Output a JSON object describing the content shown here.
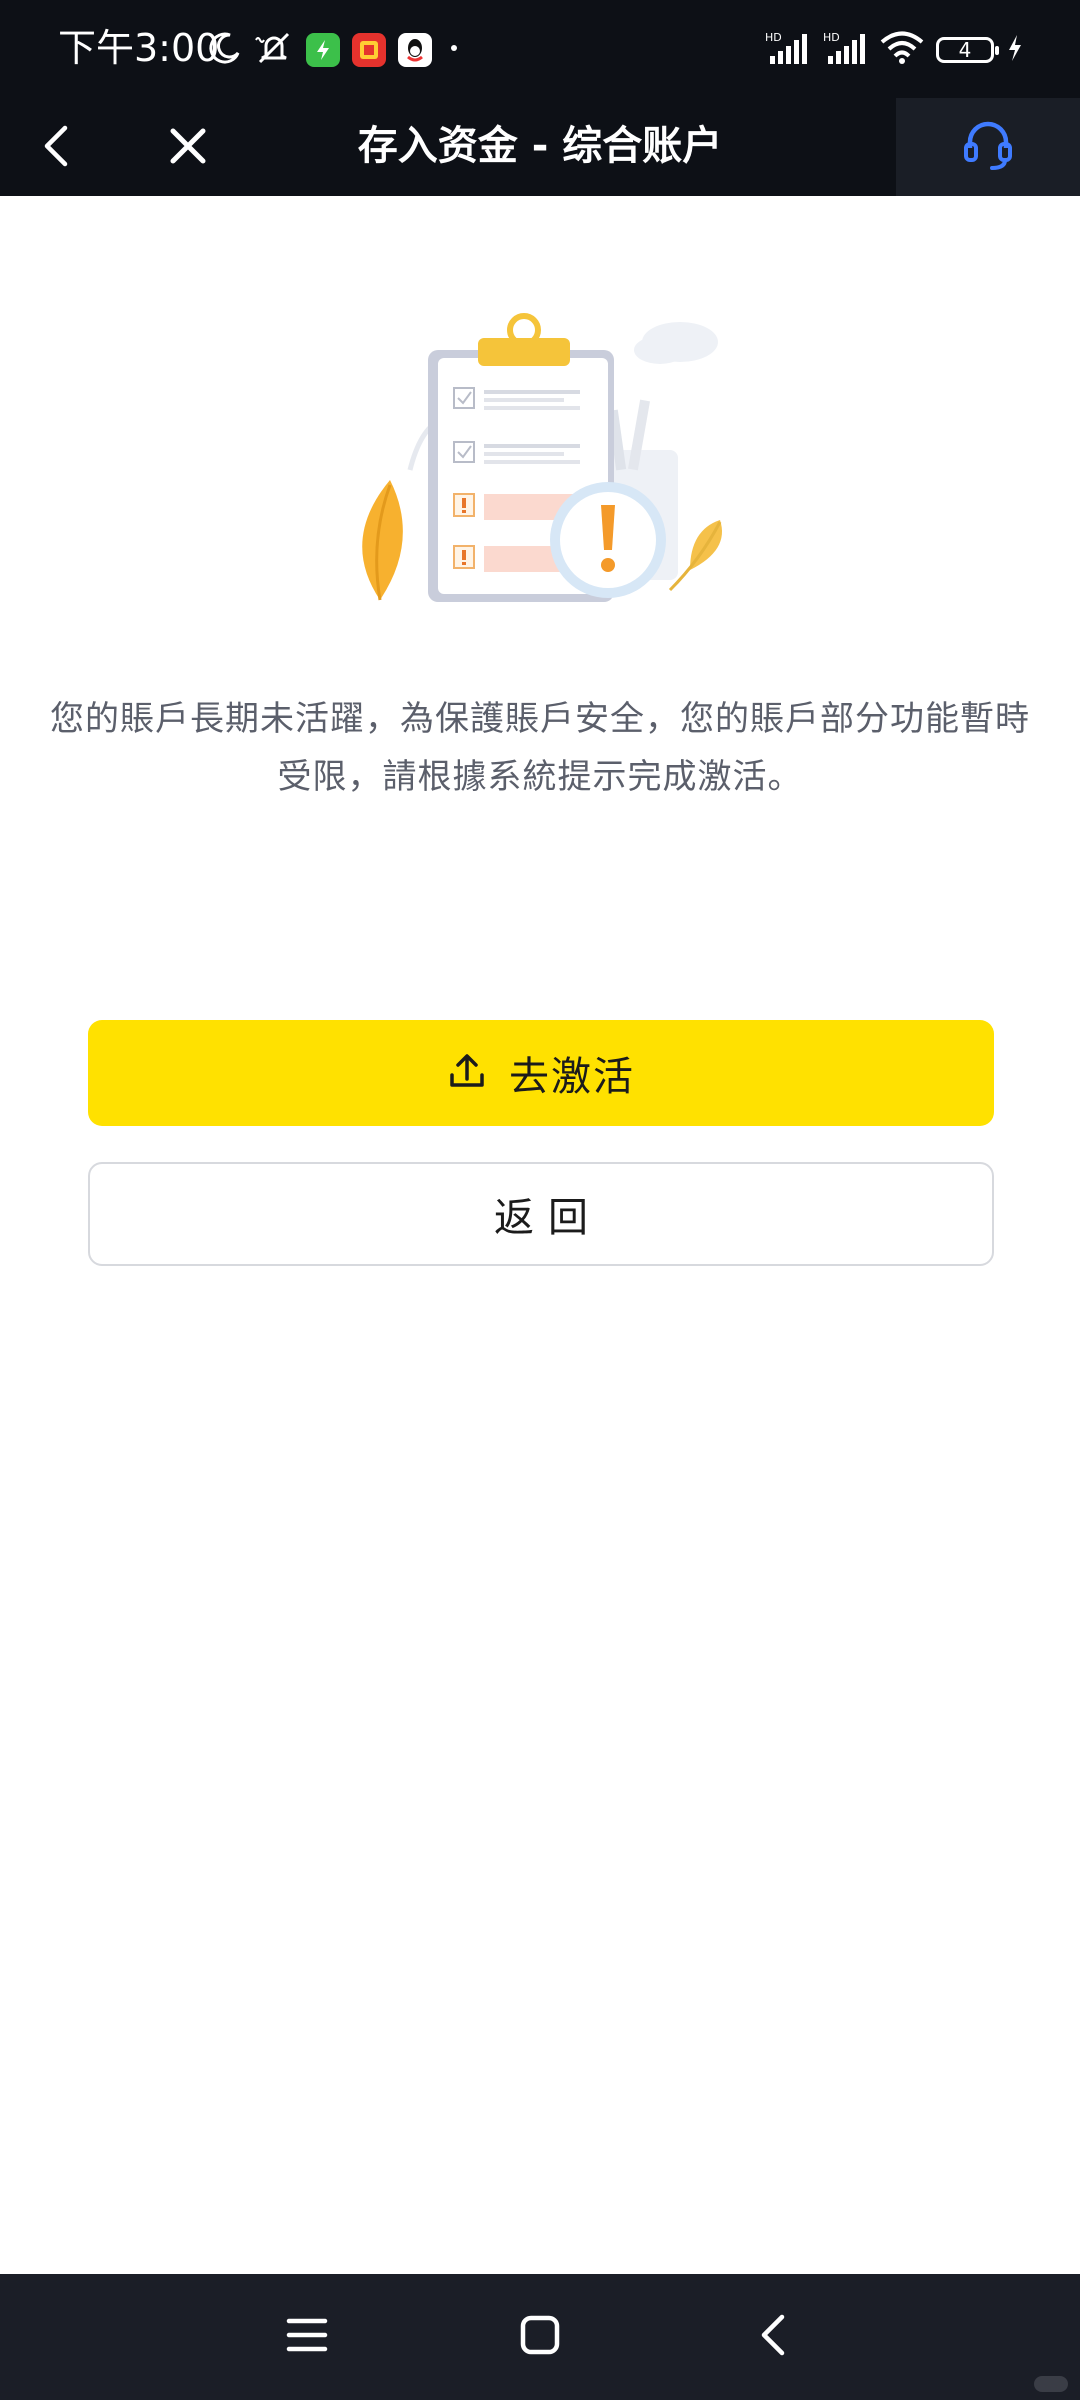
{
  "status_bar": {
    "time": "下午3:00",
    "battery_level": "4",
    "network_labels": [
      "HD",
      "HD"
    ],
    "app_icons": [
      "moon-icon",
      "bell-muted-icon",
      "green-app-icon",
      "taobao-app-icon",
      "qq-app-icon",
      "dot-icon"
    ]
  },
  "nav": {
    "title": "存入资金 - 综合账户"
  },
  "content": {
    "message": "您的賬戶長期未活躍，為保護賬戶安全，您的賬戶部分功能暫時受限，請根據系統提示完成激活。"
  },
  "buttons": {
    "activate_label": "去激活",
    "return_label": "返回"
  },
  "colors": {
    "header_bg": "#0d1016",
    "accent_yellow": "#ffe100",
    "support_icon": "#3f7bff",
    "text_gray": "#5b5f6b"
  }
}
